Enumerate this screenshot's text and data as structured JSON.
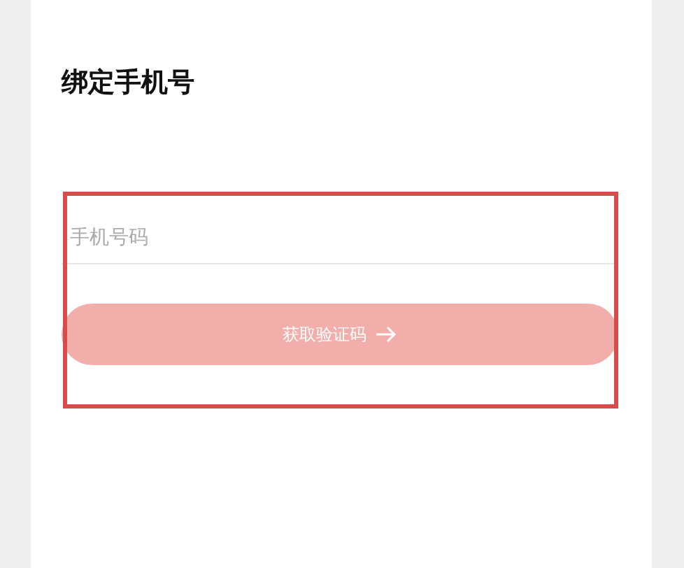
{
  "title": "绑定手机号",
  "phone_field": {
    "placeholder": "手机号码"
  },
  "submit_button": {
    "label": "获取验证码",
    "disabled": true
  },
  "annotation": {
    "color": "#d94a4a"
  }
}
